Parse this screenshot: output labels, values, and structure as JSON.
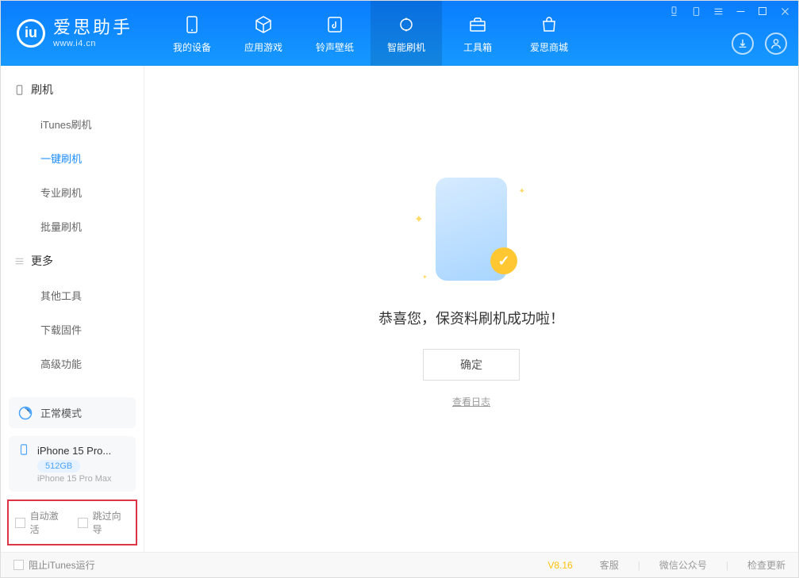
{
  "app": {
    "title": "爱思助手",
    "subtitle": "www.i4.cn"
  },
  "nav": {
    "items": [
      {
        "label": "我的设备"
      },
      {
        "label": "应用游戏"
      },
      {
        "label": "铃声壁纸"
      },
      {
        "label": "智能刷机"
      },
      {
        "label": "工具箱"
      },
      {
        "label": "爱思商城"
      }
    ]
  },
  "sidebar": {
    "group1": {
      "header": "刷机",
      "items": [
        {
          "label": "iTunes刷机"
        },
        {
          "label": "一键刷机"
        },
        {
          "label": "专业刷机"
        },
        {
          "label": "批量刷机"
        }
      ]
    },
    "group2": {
      "header": "更多",
      "items": [
        {
          "label": "其他工具"
        },
        {
          "label": "下载固件"
        },
        {
          "label": "高级功能"
        }
      ]
    },
    "status": {
      "label": "正常模式"
    },
    "device": {
      "name": "iPhone 15 Pro...",
      "storage": "512GB",
      "model": "iPhone 15 Pro Max"
    },
    "checks": {
      "auto_activate": "自动激活",
      "skip_wizard": "跳过向导"
    }
  },
  "main": {
    "success_text": "恭喜您，保资料刷机成功啦！",
    "ok_button": "确定",
    "view_log": "查看日志"
  },
  "footer": {
    "block_itunes": "阻止iTunes运行",
    "version": "V8.16",
    "links": [
      {
        "label": "客服"
      },
      {
        "label": "微信公众号"
      },
      {
        "label": "检查更新"
      }
    ]
  }
}
